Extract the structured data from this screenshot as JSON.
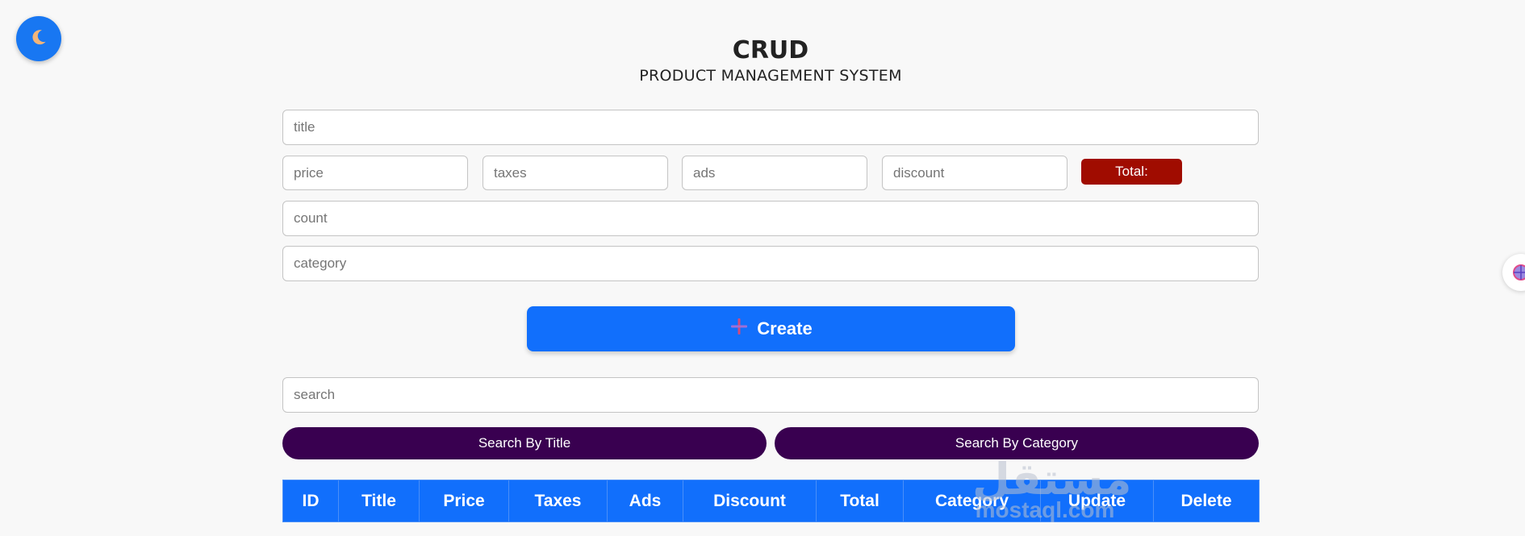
{
  "header": {
    "title": "CRUD",
    "subtitle": "PRODUCT MANAGEMENT SYSTEM"
  },
  "theme_toggle": {
    "icon": "moon-icon"
  },
  "form": {
    "title_placeholder": "title",
    "price_placeholder": "price",
    "taxes_placeholder": "taxes",
    "ads_placeholder": "ads",
    "discount_placeholder": "discount",
    "total_label": "Total:",
    "count_placeholder": "count",
    "category_placeholder": "category",
    "create_label": "Create",
    "create_icon": "plus-icon"
  },
  "search": {
    "placeholder": "search",
    "by_title_label": "Search By Title",
    "by_category_label": "Search By Category"
  },
  "table": {
    "columns": [
      "ID",
      "Title",
      "Price",
      "Taxes",
      "Ads",
      "Discount",
      "Total",
      "Category",
      "Update",
      "Delete"
    ]
  },
  "watermark": {
    "arabic": "مستقل",
    "latin": "mostaql.com"
  },
  "colors": {
    "accent": "#116ffc",
    "total_badge": "#a00c00",
    "search_buttons": "#390050",
    "background": "#f8f8f8"
  }
}
